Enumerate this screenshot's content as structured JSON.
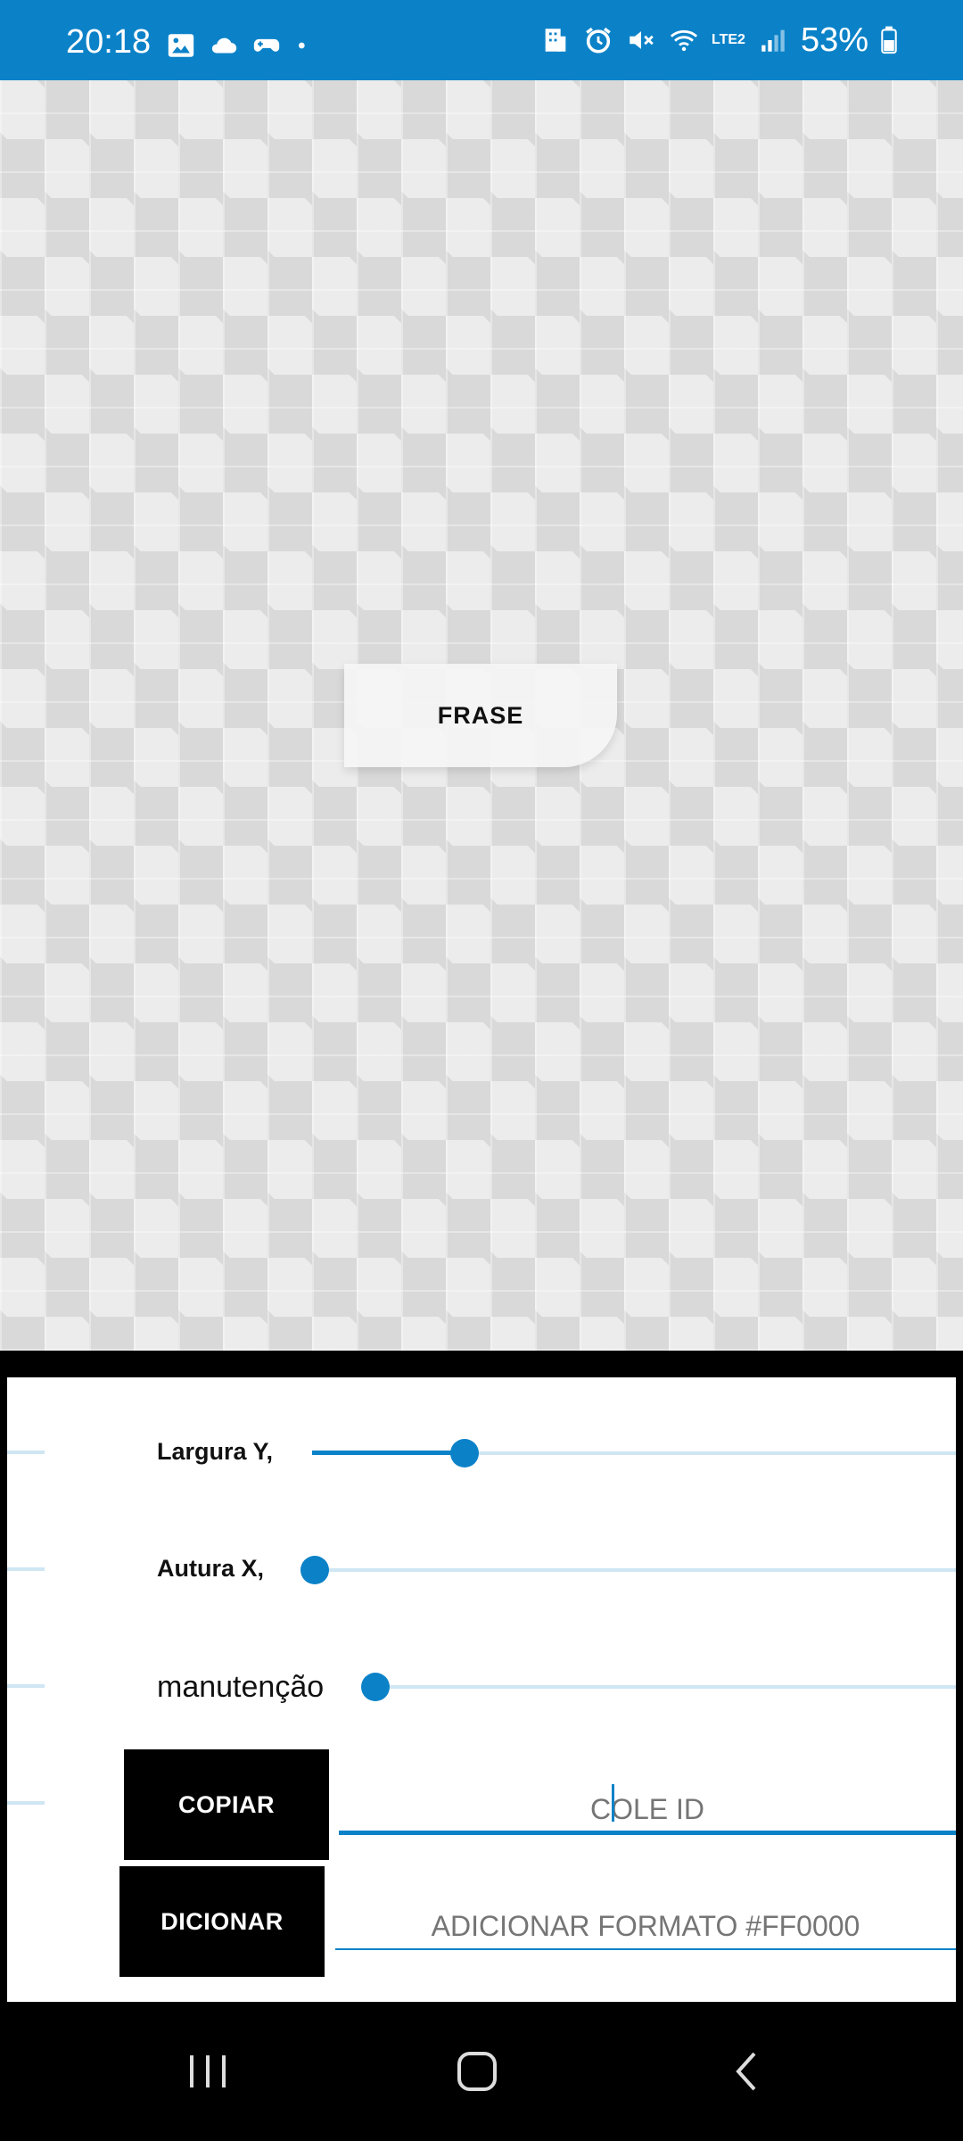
{
  "status": {
    "time": "20:18",
    "battery": "53%",
    "network": "LTE2",
    "left_icons": [
      "gallery-icon",
      "cloud-icon",
      "game-controller-icon",
      "dot-icon"
    ],
    "right_icons": [
      "building-icon",
      "alarm-icon",
      "mute-icon",
      "wifi-icon",
      "signal-icon",
      "battery-icon"
    ]
  },
  "canvas": {
    "phrase_label": "FRASE"
  },
  "controls": {
    "width_label": "Largura Y,",
    "width_value": 0.24,
    "height_label": "Autura X,",
    "height_value": 0.0,
    "maintenance_label": "manutenção",
    "maintenance_value": 0.0,
    "copy_button": "COPIAR",
    "id_placeholder": "COLE ID",
    "add_button": "DICIONAR",
    "format_placeholder": "ADICIONAR FORMATO #FF0000"
  },
  "colors": {
    "accent": "#0b82c8",
    "track": "#cfe6f3"
  },
  "nav": {
    "recents": "recents-icon",
    "home": "home-icon",
    "back": "back-icon"
  }
}
